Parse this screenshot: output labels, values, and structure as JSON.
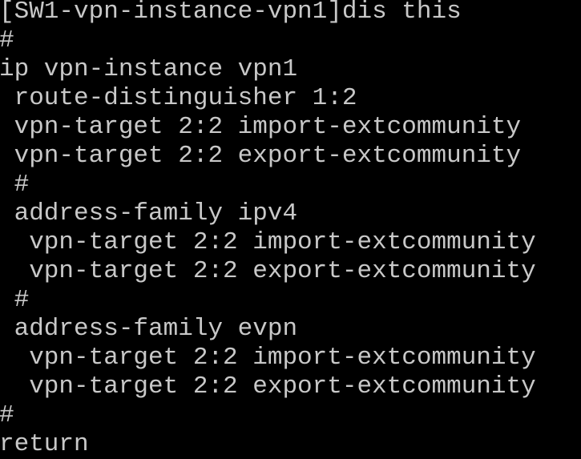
{
  "terminal": {
    "lines": [
      "[SW1-vpn-instance-vpn1]dis this",
      "#",
      "ip vpn-instance vpn1",
      " route-distinguisher 1:2",
      " vpn-target 2:2 import-extcommunity",
      " vpn-target 2:2 export-extcommunity",
      " #",
      " address-family ipv4",
      "  vpn-target 2:2 import-extcommunity",
      "  vpn-target 2:2 export-extcommunity",
      " #",
      " address-family evpn",
      "  vpn-target 2:2 import-extcommunity",
      "  vpn-target 2:2 export-extcommunity",
      "#",
      "return"
    ],
    "colors": {
      "background": "#000000",
      "text": "#c8c8c8"
    }
  }
}
